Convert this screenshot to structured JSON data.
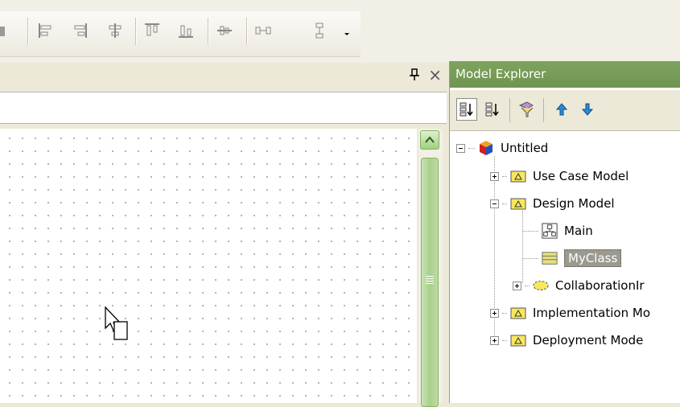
{
  "toolbar": {
    "icons": [
      "align-left-icon",
      "align-right-icon",
      "align-center-icon",
      "align-top-icon",
      "align-bottom-icon",
      "align-middle-icon",
      "space-horizontal-icon",
      "space-vertical-icon",
      "dropdown-arrow-icon"
    ]
  },
  "diagram": {
    "pin_glyph": "📌",
    "close_glyph": "×"
  },
  "explorer": {
    "title": "Model Explorer",
    "toolbar_icons": [
      "sort-by-category-icon",
      "sort-by-name-icon",
      "filter-icon",
      "move-up-icon",
      "move-down-icon"
    ],
    "tree": [
      {
        "label": "Untitled",
        "icon": "project-cube-icon",
        "expander": "minus"
      },
      {
        "label": "Use Case Model",
        "icon": "package-folder-icon",
        "expander": "plus"
      },
      {
        "label": "Design Model",
        "icon": "package-folder-icon",
        "expander": "minus"
      },
      {
        "label": "Main",
        "icon": "class-diagram-icon",
        "expander": "none"
      },
      {
        "label": "MyClass",
        "icon": "class-icon",
        "expander": "none",
        "selected": true
      },
      {
        "label": "CollaborationIr",
        "icon": "collaboration-icon",
        "expander": "plus"
      },
      {
        "label": "Implementation Mo",
        "icon": "package-folder-icon",
        "expander": "plus"
      },
      {
        "label": "Deployment Mode",
        "icon": "package-folder-icon",
        "expander": "plus"
      }
    ]
  },
  "colors": {
    "explorer_title_bg": "#6f9550",
    "scrollbar": "#a8d08b",
    "selection": "#9c9a8f"
  }
}
